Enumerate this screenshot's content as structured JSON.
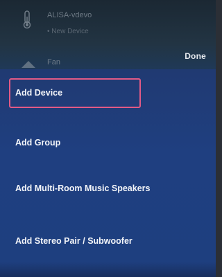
{
  "background_list": {
    "devices": [
      {
        "name": "ALISA-vdevo",
        "subtitle": "• New Device",
        "icon": "thermometer-icon"
      },
      {
        "name": "Fan",
        "subtitle": "",
        "icon": "fan-icon"
      }
    ]
  },
  "header": {
    "done_label": "Done"
  },
  "menu": {
    "items": [
      {
        "label": "Add Device",
        "highlighted": true
      },
      {
        "label": "Add Group"
      },
      {
        "label": "Add Multi-Room Music Speakers"
      },
      {
        "label": "Add Stereo Pair / Subwoofer"
      }
    ],
    "highlight_color": "#e25a86"
  },
  "colors": {
    "menu_background": "#1f3f80",
    "backdrop": "#1b2833",
    "text_primary": "#f2f4f8"
  }
}
